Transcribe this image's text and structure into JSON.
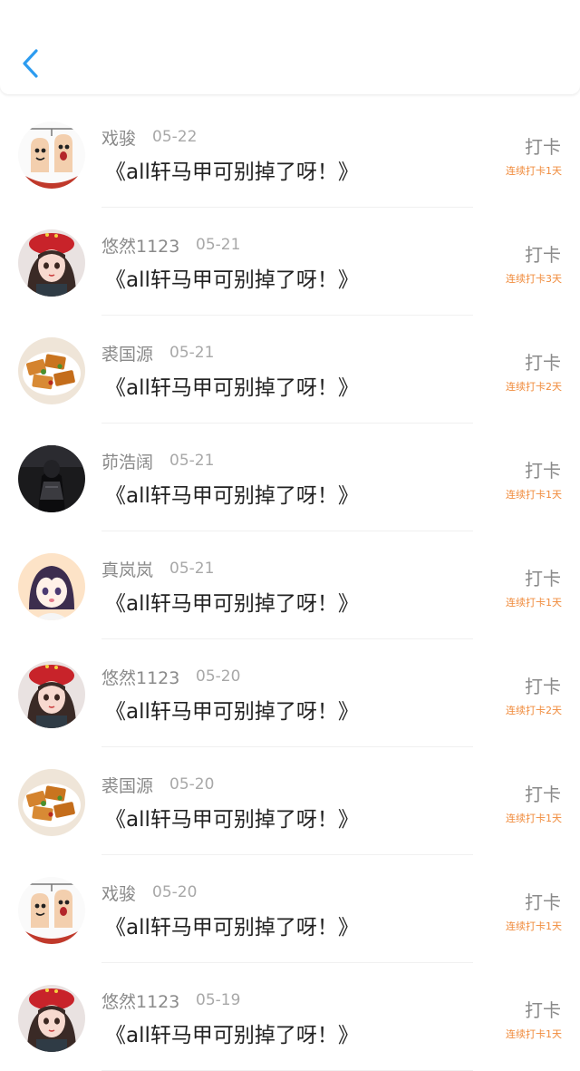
{
  "header": {
    "back_icon": "chevron-left-icon",
    "accent_color": "#2d9cf0"
  },
  "items": [
    {
      "name": "戏骏",
      "date": "05-22",
      "title": "《all轩马甲可别掉了呀！》",
      "action": "打卡",
      "streak": "连续打卡1天",
      "avatar": "finger-puppets"
    },
    {
      "name": "悠然1123",
      "date": "05-21",
      "title": "《all轩马甲可别掉了呀！》",
      "action": "打卡",
      "streak": "连续打卡3天",
      "avatar": "girl-red-hat"
    },
    {
      "name": "裘国源",
      "date": "05-21",
      "title": "《all轩马甲可别掉了呀！》",
      "action": "打卡",
      "streak": "连续打卡2天",
      "avatar": "tofu-dish"
    },
    {
      "name": "茆浩阔",
      "date": "05-21",
      "title": "《all轩马甲可别掉了呀！》",
      "action": "打卡",
      "streak": "连续打卡1天",
      "avatar": "dark-figure"
    },
    {
      "name": "真岚岚",
      "date": "05-21",
      "title": "《all轩马甲可别掉了呀！》",
      "action": "打卡",
      "streak": "连续打卡1天",
      "avatar": "anime-girl"
    },
    {
      "name": "悠然1123",
      "date": "05-20",
      "title": "《all轩马甲可别掉了呀！》",
      "action": "打卡",
      "streak": "连续打卡2天",
      "avatar": "girl-red-hat"
    },
    {
      "name": "裘国源",
      "date": "05-20",
      "title": "《all轩马甲可别掉了呀！》",
      "action": "打卡",
      "streak": "连续打卡1天",
      "avatar": "tofu-dish"
    },
    {
      "name": "戏骏",
      "date": "05-20",
      "title": "《all轩马甲可别掉了呀！》",
      "action": "打卡",
      "streak": "连续打卡1天",
      "avatar": "finger-puppets"
    },
    {
      "name": "悠然1123",
      "date": "05-19",
      "title": "《all轩马甲可别掉了呀！》",
      "action": "打卡",
      "streak": "连续打卡1天",
      "avatar": "girl-red-hat"
    }
  ]
}
